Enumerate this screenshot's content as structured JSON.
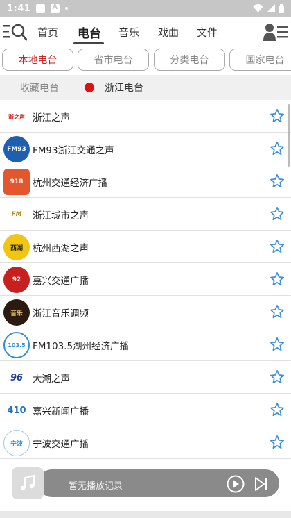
{
  "status_bar": {
    "time": "1:41"
  },
  "header": {
    "tabs": [
      {
        "label": "首页"
      },
      {
        "label": "电台"
      },
      {
        "label": "音乐"
      },
      {
        "label": "戏曲"
      },
      {
        "label": "文件"
      }
    ],
    "active_tab": "电台"
  },
  "sub_tabs": [
    {
      "label": "本地电台"
    },
    {
      "label": "省市电台"
    },
    {
      "label": "分类电台"
    },
    {
      "label": "国家电台"
    }
  ],
  "favorites_bar": {
    "label": "收藏电台",
    "current": "浙江电台"
  },
  "stations": [
    {
      "name": "浙江之声",
      "logo_color": "#ffffff",
      "logo_text": "浙之声"
    },
    {
      "name": "FM93浙江交通之声",
      "logo_color": "#1f5fb0",
      "logo_text": "FM93"
    },
    {
      "name": "杭州交通经济广播",
      "logo_color": "#e4572e",
      "logo_text": "918"
    },
    {
      "name": "浙江城市之声",
      "logo_color": "#ffffff",
      "logo_text": "FM"
    },
    {
      "name": "杭州西湖之声",
      "logo_color": "#f2c511",
      "logo_text": "西湖"
    },
    {
      "name": "嘉兴交通广播",
      "logo_color": "#c8201e",
      "logo_text": "92"
    },
    {
      "name": "浙江音乐调频",
      "logo_color": "#2a1a10",
      "logo_text": "音乐"
    },
    {
      "name": "FM103.5湖州经济广播",
      "logo_color": "#2f8fd6",
      "logo_text": "103.5"
    },
    {
      "name": "大潮之声",
      "logo_color": "#ffffff",
      "logo_text": "96"
    },
    {
      "name": "嘉兴新闻广播",
      "logo_color": "#ffffff",
      "logo_text": "410"
    },
    {
      "name": "宁波交通广播",
      "logo_color": "#ffffff",
      "logo_text": "宁波"
    }
  ],
  "player": {
    "text": "暂无播放记录"
  },
  "colors": {
    "accent_red": "#d42222",
    "star_blue": "#3a8fd8",
    "status_bar": "#c6c6c6"
  }
}
